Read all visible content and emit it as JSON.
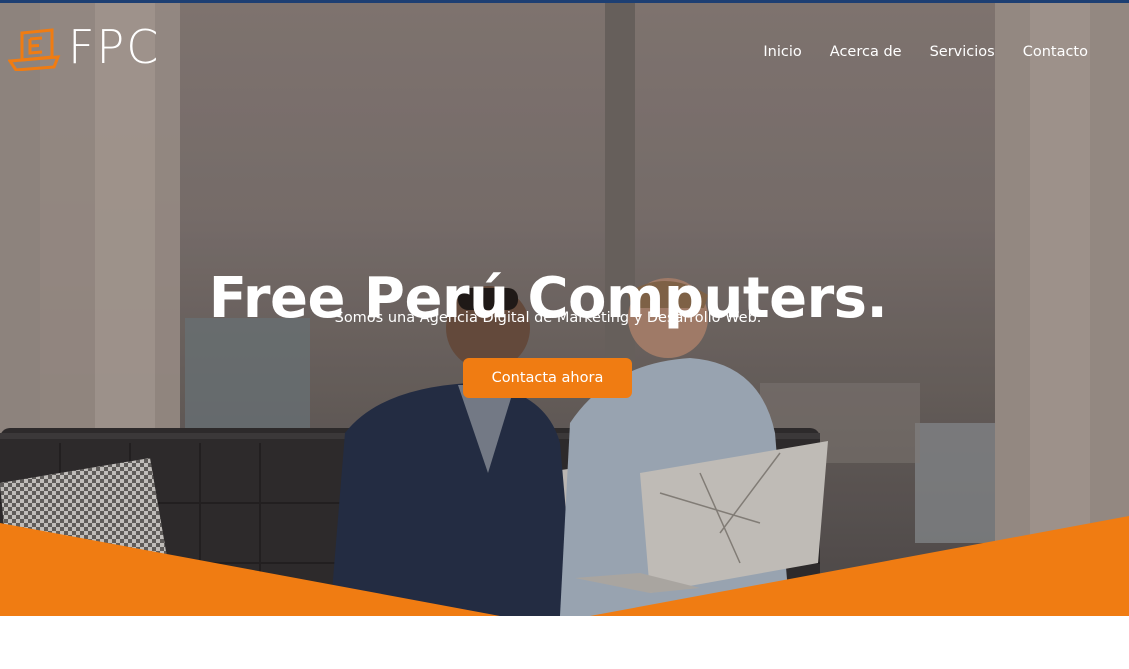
{
  "brand": {
    "logo_text": "FPC",
    "accent": "#f07c12",
    "logo_mark_icon": "laptop-e-icon"
  },
  "nav": {
    "items": [
      {
        "label": "Inicio"
      },
      {
        "label": "Acerca de"
      },
      {
        "label": "Servicios"
      },
      {
        "label": "Contacto"
      }
    ]
  },
  "hero": {
    "title": "Free Perú Computers.",
    "subtitle": "Somos una Agencia Digital de Marketing y Desarrollo Web.",
    "cta_label": "Contacta ahora",
    "background_image": "two-men-looking-at-laptop-photo"
  },
  "colors": {
    "top_line": "#1d3f73",
    "wave": "#f07c12",
    "cta": "#f07c12"
  }
}
